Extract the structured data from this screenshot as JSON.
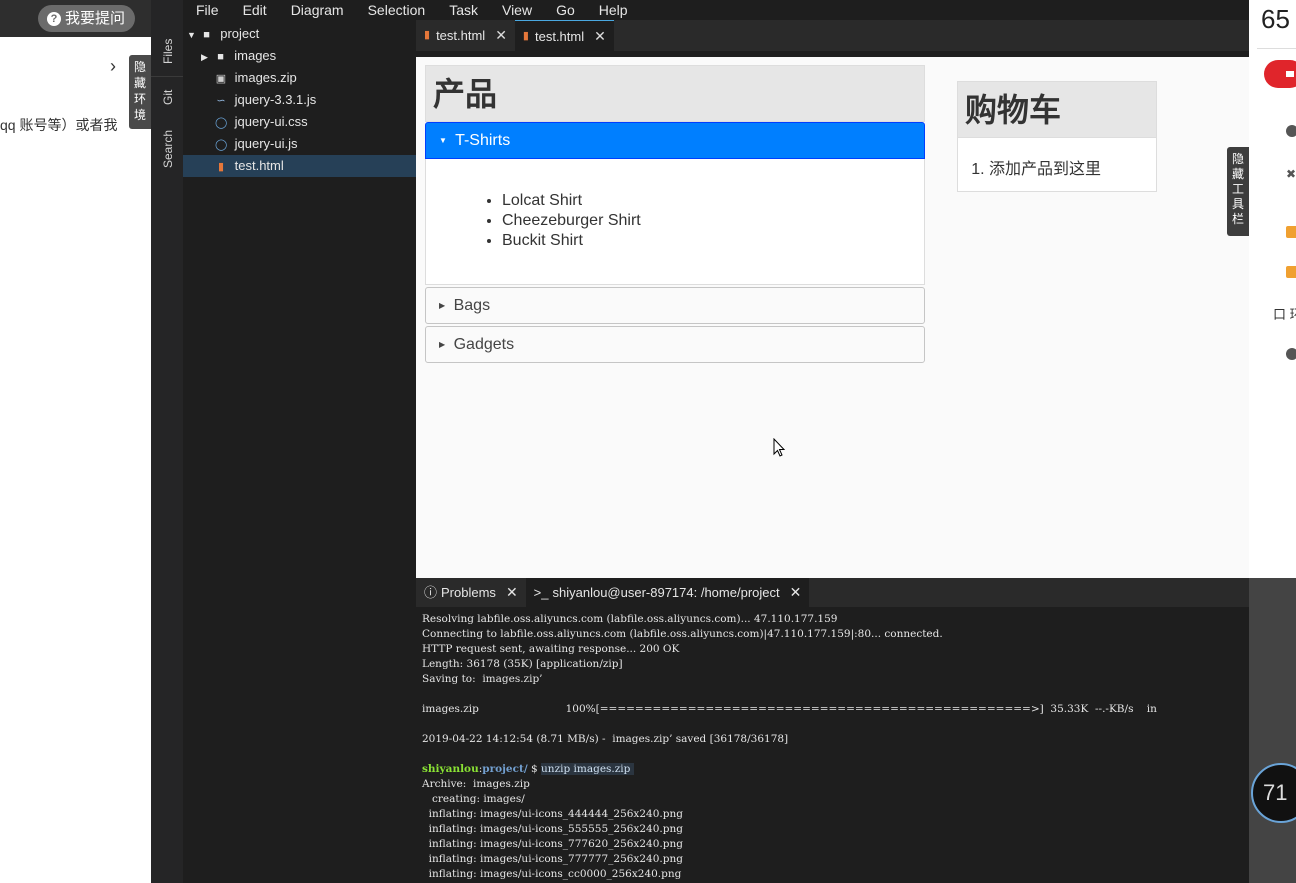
{
  "left_panel": {
    "ask_button": "我要提问",
    "course_text": "qq 账号等）或者我",
    "hide_env": [
      "隐",
      "藏",
      "环",
      "境"
    ]
  },
  "activity_bar": {
    "files": "Files",
    "git": "Git",
    "search": "Search"
  },
  "menubar": [
    "File",
    "Edit",
    "Diagram",
    "Selection",
    "Task",
    "View",
    "Go",
    "Help"
  ],
  "explorer": {
    "root": "project",
    "items": [
      "images",
      "images.zip",
      "jquery-3.3.1.js",
      "jquery-ui.css",
      "jquery-ui.js",
      "test.html"
    ]
  },
  "editor_tabs": [
    "test.html",
    "test.html"
  ],
  "preview": {
    "products_title": "产品",
    "sections": [
      "T-Shirts",
      "Bags",
      "Gadgets"
    ],
    "tshirts": [
      "Lolcat Shirt",
      "Cheezeburger Shirt",
      "Buckit Shirt"
    ],
    "cart_title": "购物车",
    "cart_placeholder": "添加产品到这里"
  },
  "panel_tabs": {
    "problems": "Problems",
    "terminal": "shiyanlou@user-897174: /home/project"
  },
  "terminal": {
    "lines": [
      "Resolving labfile.oss.aliyuncs.com (labfile.oss.aliyuncs.com)... 47.110.177.159",
      "Connecting to labfile.oss.aliyuncs.com (labfile.oss.aliyuncs.com)|47.110.177.159|:80... connected.",
      "HTTP request sent, awaiting response... 200 OK",
      "Length: 36178 (35K) [application/zip]",
      "Saving to:  images.zip’",
      "",
      "images.zip                          100%[=================================================>]  35.33K  --.-KB/s    in",
      "",
      "2019-04-22 14:12:54 (8.71 MB/s) -  images.zip’ saved [36178/36178]",
      ""
    ],
    "prompt_user": "shiyanlou",
    "prompt_path": "project/",
    "prompt_symbol": " $ ",
    "prompt_command": "unzip images.zip ",
    "output": [
      "Archive:  images.zip",
      "   creating: images/",
      "  inflating: images/ui-icons_444444_256x240.png",
      "  inflating: images/ui-icons_555555_256x240.png",
      "  inflating: images/ui-icons_777620_256x240.png",
      "  inflating: images/ui-icons_777777_256x240.png",
      "  inflating: images/ui-icons_cc0000_256x240.png"
    ]
  },
  "hide_toolbar": [
    "隐",
    "藏",
    "工",
    "具",
    "栏"
  ],
  "right_strip": {
    "number": "65",
    "text": "口 环",
    "gauge": "71"
  }
}
